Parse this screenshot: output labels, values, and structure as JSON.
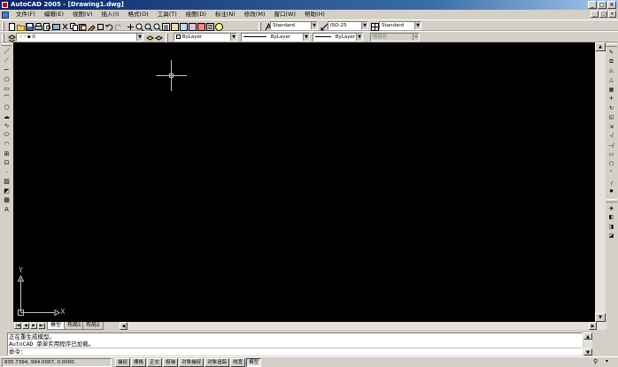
{
  "window": {
    "title": "AutoCAD 2005 - [Drawing1.dwg]",
    "buttons": [
      "_",
      "□",
      "×"
    ]
  },
  "menubar": {
    "items": [
      "文件(F)",
      "编辑(E)",
      "视图(V)",
      "插入(I)",
      "格式(O)",
      "工具(T)",
      "绘图(D)",
      "标注(N)",
      "修改(M)",
      "窗口(W)",
      "帮助(H)"
    ],
    "mdi_buttons": [
      "_",
      "□",
      "×"
    ]
  },
  "styles_toolbar": {
    "text_style": "Standard",
    "dim_style": "ISO-25",
    "table_style": "Standard"
  },
  "layers_toolbar": {
    "current_layer": "0"
  },
  "properties_toolbar": {
    "color": "ByLayer",
    "linetype": "ByLayer",
    "lineweight": "ByLayer",
    "plot_style": "随颜色"
  },
  "left_tools": [
    {
      "icon": "line-icon",
      "glyph": "／"
    },
    {
      "icon": "construction-line-icon",
      "glyph": "⟋"
    },
    {
      "icon": "polyline-icon",
      "glyph": "⌐"
    },
    {
      "icon": "polygon-icon",
      "glyph": "⬠"
    },
    {
      "icon": "rectangle-icon",
      "glyph": "▭"
    },
    {
      "icon": "arc-icon",
      "glyph": "⌒"
    },
    {
      "icon": "circle-icon",
      "glyph": "○"
    },
    {
      "icon": "revision-cloud-icon",
      "glyph": "☁"
    },
    {
      "icon": "spline-icon",
      "glyph": "∿"
    },
    {
      "icon": "ellipse-icon",
      "glyph": "⬭"
    },
    {
      "icon": "ellipse-arc-icon",
      "glyph": "◠"
    },
    {
      "icon": "insert-block-icon",
      "glyph": "⊞"
    },
    {
      "icon": "make-block-icon",
      "glyph": "⊡"
    },
    {
      "icon": "point-icon",
      "glyph": "·"
    },
    {
      "icon": "hatch-icon",
      "glyph": "▨"
    },
    {
      "icon": "region-icon",
      "glyph": "◩"
    },
    {
      "icon": "table-icon",
      "glyph": "▦"
    },
    {
      "icon": "multiline-text-icon",
      "glyph": "A"
    }
  ],
  "right_tools_top": [
    {
      "icon": "erase-icon",
      "glyph": "✎"
    },
    {
      "icon": "copy-icon",
      "glyph": "⧉"
    },
    {
      "icon": "mirror-icon",
      "glyph": "⚠"
    },
    {
      "icon": "offset-icon",
      "glyph": "△"
    },
    {
      "icon": "array-icon",
      "glyph": "▦"
    },
    {
      "icon": "move-icon",
      "glyph": "✛"
    },
    {
      "icon": "rotate-icon",
      "glyph": "↻"
    },
    {
      "icon": "scale-icon",
      "glyph": "◱"
    },
    {
      "icon": "stretch-icon",
      "glyph": "⇲"
    },
    {
      "icon": "trim-icon",
      "glyph": "-/"
    },
    {
      "icon": "extend-icon",
      "glyph": "--/"
    },
    {
      "icon": "break-at-point-icon",
      "glyph": "▭"
    },
    {
      "icon": "break-icon",
      "glyph": "⬠"
    },
    {
      "icon": "chamfer-icon",
      "glyph": "⌜"
    },
    {
      "icon": "fillet-icon",
      "glyph": "╭"
    },
    {
      "icon": "explode-icon",
      "glyph": "✸"
    }
  ],
  "right_tools_bottom": [
    {
      "icon": "draw-order-icon",
      "glyph": "◈"
    },
    {
      "icon": "bring-front-icon",
      "glyph": "◧"
    },
    {
      "icon": "send-back-icon",
      "glyph": "◨"
    },
    {
      "icon": "above-object-icon",
      "glyph": "◪"
    }
  ],
  "ucs": {
    "x_label": "X",
    "y_label": "Y"
  },
  "tabs": [
    "模型",
    "布局1",
    "布局2"
  ],
  "command_line": {
    "history": [
      "正在重生成模型。",
      "AutoCAD 菜单实用程序已加载。"
    ],
    "prompt": "命令："
  },
  "status": {
    "coordinates": "835.7394, 994.0067, 0.0000",
    "buttons": [
      {
        "label": "捕捉",
        "on": false
      },
      {
        "label": "栅格",
        "on": false
      },
      {
        "label": "正交",
        "on": false
      },
      {
        "label": "极轴",
        "on": false
      },
      {
        "label": "对象捕捉",
        "on": false
      },
      {
        "label": "对象追踪",
        "on": false
      },
      {
        "label": "线宽",
        "on": false
      },
      {
        "label": "模型",
        "on": true
      }
    ]
  }
}
